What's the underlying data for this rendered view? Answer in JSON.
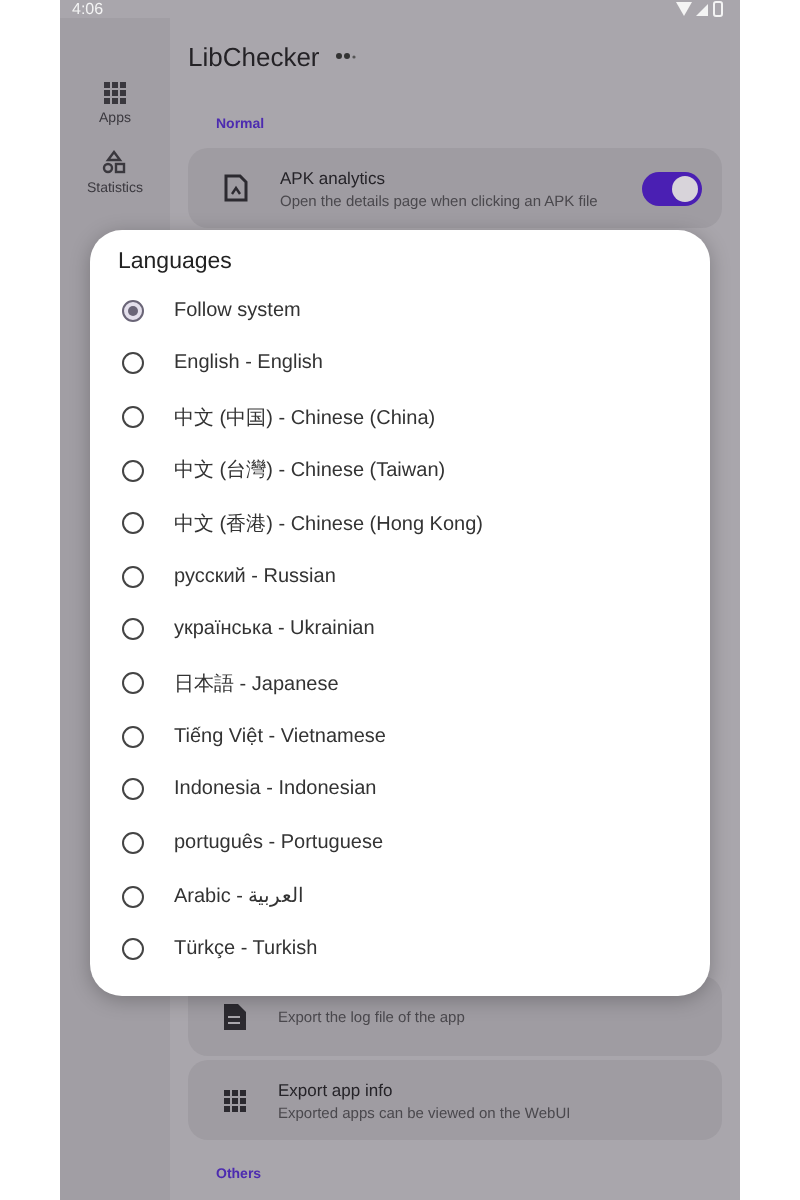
{
  "status_bar": {
    "time": "4:06"
  },
  "rail": {
    "items": [
      {
        "label": "Apps",
        "selected": false
      },
      {
        "label": "Statistics",
        "selected": false
      }
    ]
  },
  "app_bar": {
    "title": "LibChecker"
  },
  "sections": [
    {
      "header": "Normal",
      "cards": [
        {
          "title": "APK analytics",
          "subtitle": "Open the details page when clicking an APK file",
          "kind": "switch",
          "on": true
        }
      ]
    },
    {
      "cards": [
        {
          "subtitle": "Export the log file of the app",
          "kind": "plain"
        },
        {
          "title": "Export app info",
          "subtitle": "Exported apps can be viewed on the WebUI",
          "kind": "plain"
        }
      ]
    },
    {
      "header": "Others"
    }
  ],
  "dialog": {
    "title": "Languages",
    "options": [
      {
        "label": "Follow system",
        "selected": true
      },
      {
        "label": "English - English",
        "selected": false
      },
      {
        "label": "中文 (中国) - Chinese (China)",
        "selected": false
      },
      {
        "label": "中文 (台灣) - Chinese (Taiwan)",
        "selected": false
      },
      {
        "label": "中文 (香港) - Chinese (Hong Kong)",
        "selected": false
      },
      {
        "label": "русский - Russian",
        "selected": false
      },
      {
        "label": "українська - Ukrainian",
        "selected": false
      },
      {
        "label": "日本語 - Japanese",
        "selected": false
      },
      {
        "label": "Tiếng Việt - Vietnamese",
        "selected": false
      },
      {
        "label": "Indonesia - Indonesian",
        "selected": false
      },
      {
        "label": "português - Portuguese",
        "selected": false
      },
      {
        "label": "Arabic - العربية",
        "selected": false
      },
      {
        "label": "Türkçe - Turkish",
        "selected": false
      }
    ]
  }
}
